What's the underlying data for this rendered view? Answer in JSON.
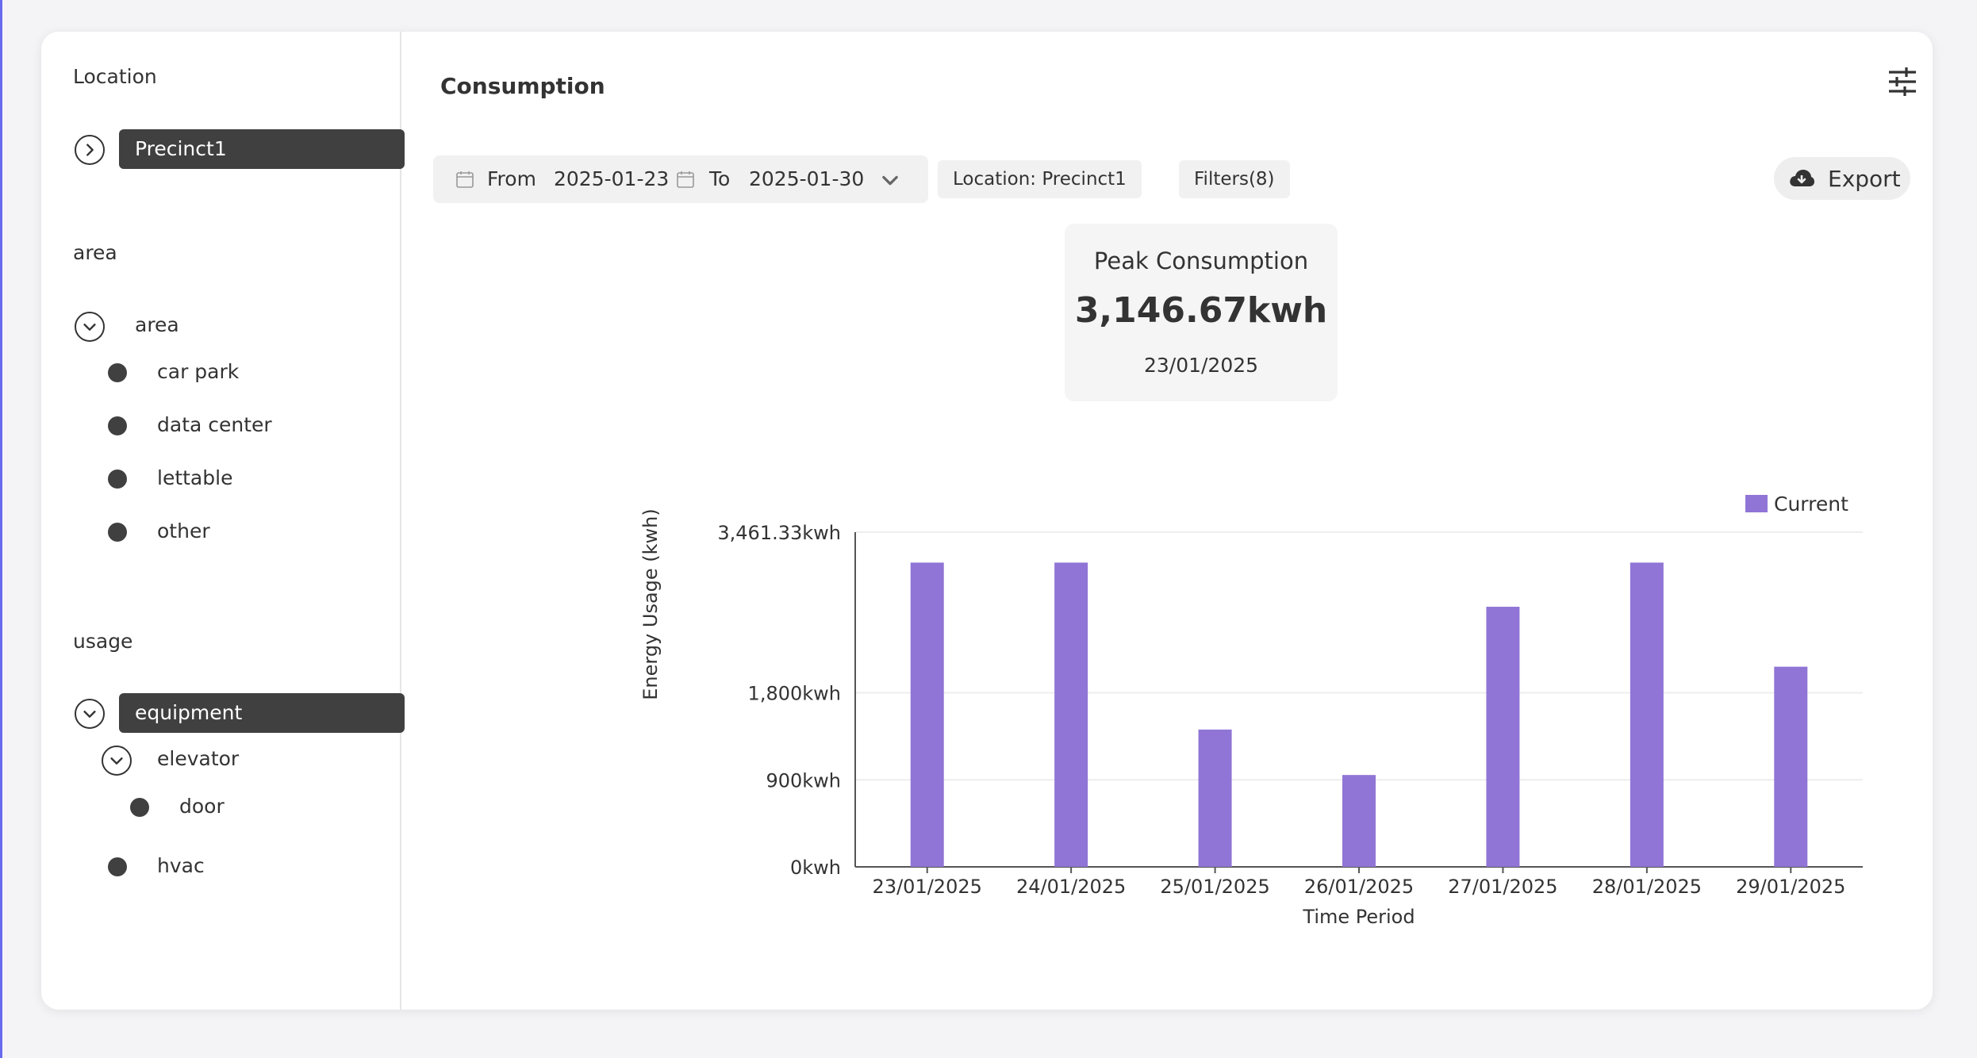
{
  "sidebar": {
    "location_label": "Location",
    "location_selected": "Precinct1",
    "area_label": "area",
    "area_group": "area",
    "area_items": [
      "car park",
      "data center",
      "lettable",
      "other"
    ],
    "usage_label": "usage",
    "usage_selected": "equipment",
    "usage_sub": "elevator",
    "usage_sub_item": "door",
    "usage_other": "hvac"
  },
  "main": {
    "title": "Consumption",
    "from_label": "From",
    "from_date": "2025-01-23",
    "to_label": "To",
    "to_date": "2025-01-30",
    "location_chip": "Location: Precinct1",
    "filters_chip": "Filters(8)",
    "export_label": "Export"
  },
  "peak": {
    "title": "Peak Consumption",
    "value": "3,146.67kwh",
    "date": "23/01/2025"
  },
  "colors": {
    "bar": "#9075d6",
    "selected_pill": "#404040"
  },
  "chart_data": {
    "type": "bar",
    "categories": [
      "23/01/2025",
      "24/01/2025",
      "25/01/2025",
      "26/01/2025",
      "27/01/2025",
      "28/01/2025",
      "29/01/2025"
    ],
    "series": [
      {
        "name": "Current",
        "values": [
          3146.67,
          3146.67,
          1420,
          950,
          2690,
          3146.67,
          2070
        ]
      }
    ],
    "xlabel": "Time Period",
    "ylabel": "Energy Usage (kwh)",
    "ylim": [
      0,
      3461.33
    ],
    "yticks": [
      0,
      900,
      1800,
      3461.33
    ],
    "ytick_labels": [
      "0kwh",
      "900kwh",
      "1,800kwh",
      "3,461.33kwh"
    ],
    "legend": "top-right",
    "grid": true
  }
}
